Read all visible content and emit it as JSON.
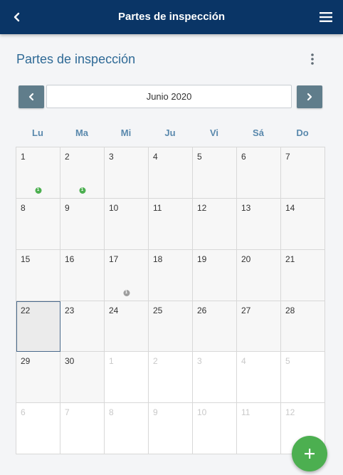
{
  "header": {
    "title": "Partes de inspección"
  },
  "page": {
    "title": "Partes de inspección"
  },
  "calendar": {
    "month_label": "Junio 2020",
    "weekdays": [
      "Lu",
      "Ma",
      "Mi",
      "Ju",
      "Vi",
      "Sá",
      "Do"
    ],
    "today": "22",
    "cells": [
      {
        "day": "1",
        "in_month": true,
        "badge": "1",
        "badge_color": "#4caf50"
      },
      {
        "day": "2",
        "in_month": true,
        "badge": "1",
        "badge_color": "#4caf50"
      },
      {
        "day": "3",
        "in_month": true
      },
      {
        "day": "4",
        "in_month": true
      },
      {
        "day": "5",
        "in_month": true
      },
      {
        "day": "6",
        "in_month": true
      },
      {
        "day": "7",
        "in_month": true
      },
      {
        "day": "8",
        "in_month": true
      },
      {
        "day": "9",
        "in_month": true
      },
      {
        "day": "10",
        "in_month": true
      },
      {
        "day": "11",
        "in_month": true
      },
      {
        "day": "12",
        "in_month": true
      },
      {
        "day": "13",
        "in_month": true
      },
      {
        "day": "14",
        "in_month": true
      },
      {
        "day": "15",
        "in_month": true
      },
      {
        "day": "16",
        "in_month": true
      },
      {
        "day": "17",
        "in_month": true,
        "badge": "1",
        "badge_color": "#9e9e9e"
      },
      {
        "day": "18",
        "in_month": true
      },
      {
        "day": "19",
        "in_month": true
      },
      {
        "day": "20",
        "in_month": true
      },
      {
        "day": "21",
        "in_month": true
      },
      {
        "day": "22",
        "in_month": true
      },
      {
        "day": "23",
        "in_month": true
      },
      {
        "day": "24",
        "in_month": true
      },
      {
        "day": "25",
        "in_month": true
      },
      {
        "day": "26",
        "in_month": true
      },
      {
        "day": "27",
        "in_month": true
      },
      {
        "day": "28",
        "in_month": true
      },
      {
        "day": "29",
        "in_month": true
      },
      {
        "day": "30",
        "in_month": true
      },
      {
        "day": "1",
        "in_month": false
      },
      {
        "day": "2",
        "in_month": false
      },
      {
        "day": "3",
        "in_month": false
      },
      {
        "day": "4",
        "in_month": false
      },
      {
        "day": "5",
        "in_month": false
      },
      {
        "day": "6",
        "in_month": false
      },
      {
        "day": "7",
        "in_month": false
      },
      {
        "day": "8",
        "in_month": false
      },
      {
        "day": "9",
        "in_month": false
      },
      {
        "day": "10",
        "in_month": false
      },
      {
        "day": "11",
        "in_month": false
      },
      {
        "day": "12",
        "in_month": false
      }
    ]
  },
  "icons": {
    "back": "chevron-left-icon",
    "menu": "hamburger-menu-icon",
    "more": "more-vertical-icon",
    "prev": "chevron-left-icon",
    "next": "chevron-right-icon",
    "add": "plus-icon"
  },
  "colors": {
    "header_bg": "#0a3566",
    "accent": "#2f6a96",
    "nav_button": "#607d8b",
    "fab": "#4caf50"
  }
}
